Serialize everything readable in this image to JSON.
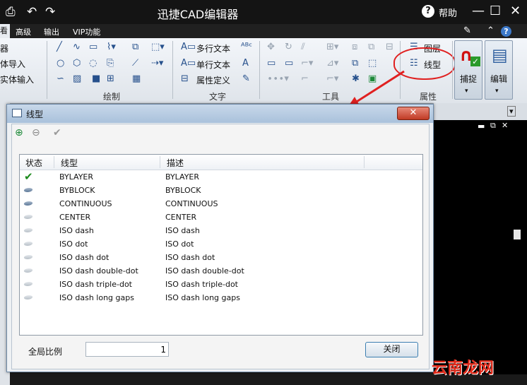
{
  "app": {
    "title": "迅捷CAD编辑器",
    "help_label": "帮助"
  },
  "menu": {
    "active": "看",
    "items": [
      "高级",
      "输出",
      "VIP功能"
    ]
  },
  "ribbon": {
    "left_items": [
      "器",
      "体导入",
      "实体输入"
    ],
    "groups": [
      "绘制",
      "文字",
      "工具",
      "属性"
    ],
    "text_tools": [
      "多行文本",
      "单行文本",
      "属性定义"
    ],
    "prop_tools": [
      "图层",
      "线型"
    ],
    "big_buttons": [
      "捕捉",
      "编辑"
    ]
  },
  "dialog": {
    "title": "线型",
    "columns": [
      "状态",
      "线型",
      "描述"
    ],
    "rows": [
      {
        "state": "current",
        "name": "BYLAYER",
        "desc": "BYLAYER"
      },
      {
        "state": "icon",
        "name": "BYBLOCK",
        "desc": "BYBLOCK"
      },
      {
        "state": "icon",
        "name": "CONTINUOUS",
        "desc": "CONTINUOUS"
      },
      {
        "state": "dim",
        "name": "CENTER",
        "desc": "CENTER"
      },
      {
        "state": "dim",
        "name": "ISO dash",
        "desc": "ISO dash"
      },
      {
        "state": "dim",
        "name": "ISO dot",
        "desc": "ISO dot"
      },
      {
        "state": "dim",
        "name": "ISO dash dot",
        "desc": "ISO dash dot"
      },
      {
        "state": "dim",
        "name": "ISO dash double-dot",
        "desc": "ISO dash double-dot"
      },
      {
        "state": "dim",
        "name": "ISO dash triple-dot",
        "desc": "ISO dash triple-dot"
      },
      {
        "state": "dim",
        "name": "ISO dash long gaps",
        "desc": "ISO dash long gaps"
      }
    ],
    "scale_label": "全局比例",
    "scale_value": "1",
    "close_label": "关闭"
  },
  "watermark": "云南龙网"
}
